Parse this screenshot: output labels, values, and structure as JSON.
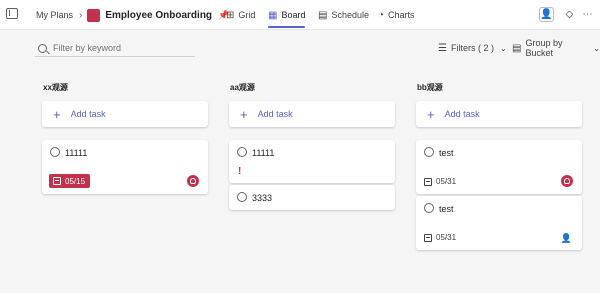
{
  "header": {
    "breadcrumb": "My Plans",
    "plan_icon_letter": "",
    "plan_title": "Employee Onboarding",
    "tabs": [
      {
        "label": "Grid",
        "icon": "grid-icon"
      },
      {
        "label": "Board",
        "icon": "board-icon",
        "active": true
      },
      {
        "label": "Schedule",
        "icon": "schedule-icon"
      },
      {
        "label": "Charts",
        "icon": "charts-icon"
      }
    ],
    "right_icons": [
      "share-member-icon",
      "premium-diamond-icon",
      "more-icon"
    ]
  },
  "toolbar": {
    "search_placeholder": "Filter by keyword",
    "filters_label": "Filters ( 2 )",
    "group_label": "Group by Bucket"
  },
  "buckets": [
    {
      "name": "xx观源",
      "add_label": "Add task",
      "tasks": [
        {
          "title": "11111",
          "due": "05/15",
          "due_style": "overdue",
          "assignee": "avatar"
        }
      ]
    },
    {
      "name": "aa观源",
      "add_label": "Add task",
      "tasks": [
        {
          "title": "11111",
          "priority": "!"
        },
        {
          "title": "3333"
        }
      ]
    },
    {
      "name": "bb观源",
      "add_label": "Add task",
      "tasks": [
        {
          "title": "test",
          "due": "05/31",
          "assignee": "avatar"
        },
        {
          "title": "test",
          "due": "05/31",
          "assignee": "assign-icon"
        }
      ]
    }
  ],
  "colors": {
    "accent": "#5b5fc7",
    "overdue": "#c4314b",
    "plan_icon": "#c4314b"
  }
}
